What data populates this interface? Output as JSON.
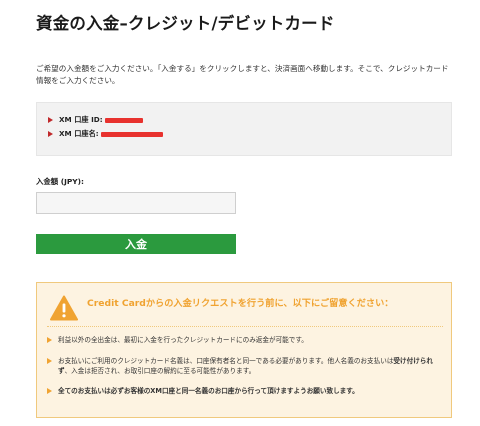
{
  "page": {
    "title": "資金の入金–クレジット/デビットカード",
    "intro": "ご希望の入金額をご入力ください。「入金する」をクリックしますと、決済画面へ移動します。そこで、クレジットカード情報をご入力ください。"
  },
  "account": {
    "id_label": "XM 口座 ID:",
    "name_label": "XM 口座名:"
  },
  "form": {
    "amount_label": "入金額 (JPY):",
    "amount_value": "",
    "submit_label": "入金"
  },
  "notice": {
    "title": "Credit Cardからの入金リクエストを行う前に、以下にご留意ください：",
    "item1": "利益以外の全出金は、最初に入金を行ったクレジットカードにのみ返金が可能です。",
    "item2_pre": "お支払いにご利用のクレジットカード名義は、口座保有者名と同一である必要があります。他人名義のお支払いは",
    "item2_bold": "受け付けられず",
    "item2_post": "、入金は拒否され、お取引口座の解約に至る可能性があります。",
    "item3": "全てのお支払いは必ずお客様のXM口座と同一名義のお口座から行って頂けますようお願い致します。"
  },
  "colors": {
    "accent_green": "#2b9a3e",
    "warning_orange": "#f0a331",
    "redaction_red": "#e8322e",
    "bullet_red": "#c0292b"
  },
  "icons": [
    "red-arrow-bullet-icon",
    "warning-triangle-icon",
    "orange-arrow-bullet-icon"
  ]
}
